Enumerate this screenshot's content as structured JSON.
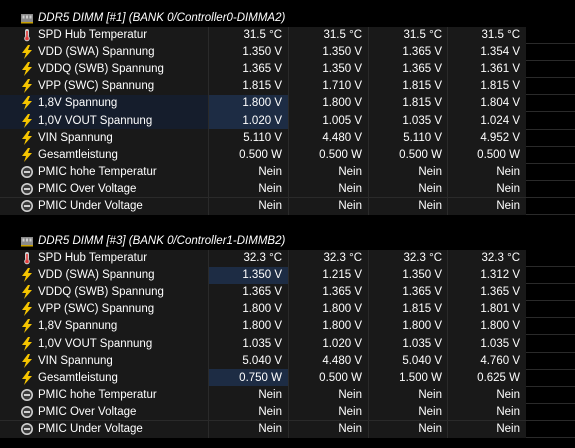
{
  "groups": [
    {
      "title": "DDR5 DIMM [#1] (BANK 0/Controller0-DIMMA2)",
      "rows": [
        {
          "icon": "thermometer-icon",
          "label": "SPD Hub Temperatur",
          "values": [
            "31.5 °C",
            "31.5 °C",
            "31.5 °C",
            "31.5 °C"
          ],
          "highlight": [
            false,
            false,
            false,
            false
          ]
        },
        {
          "icon": "lightning-icon",
          "label": "VDD (SWA) Spannung",
          "values": [
            "1.350 V",
            "1.350 V",
            "1.365 V",
            "1.354 V"
          ],
          "highlight": [
            false,
            false,
            false,
            false
          ]
        },
        {
          "icon": "lightning-icon",
          "label": "VDDQ (SWB) Spannung",
          "values": [
            "1.365 V",
            "1.350 V",
            "1.365 V",
            "1.361 V"
          ],
          "highlight": [
            false,
            false,
            false,
            false
          ]
        },
        {
          "icon": "lightning-icon",
          "label": "VPP (SWC) Spannung",
          "values": [
            "1.815 V",
            "1.710 V",
            "1.815 V",
            "1.815 V"
          ],
          "highlight": [
            false,
            false,
            false,
            false
          ]
        },
        {
          "icon": "lightning-icon",
          "label": "1,8V Spannung",
          "values": [
            "1.800 V",
            "1.800 V",
            "1.815 V",
            "1.804 V"
          ],
          "highlight": [
            true,
            false,
            false,
            false
          ],
          "row_hl": true
        },
        {
          "icon": "lightning-icon",
          "label": "1,0V VOUT Spannung",
          "values": [
            "1.020 V",
            "1.005 V",
            "1.035 V",
            "1.024 V"
          ],
          "highlight": [
            true,
            false,
            false,
            false
          ],
          "row_hl": true
        },
        {
          "icon": "lightning-icon",
          "label": "VIN Spannung",
          "values": [
            "5.110 V",
            "4.480 V",
            "5.110 V",
            "4.952 V"
          ],
          "highlight": [
            false,
            false,
            false,
            false
          ]
        },
        {
          "icon": "lightning-icon",
          "label": "Gesamtleistung",
          "values": [
            "0.500 W",
            "0.500 W",
            "0.500 W",
            "0.500 W"
          ],
          "highlight": [
            false,
            false,
            false,
            false
          ]
        },
        {
          "icon": "status-circle-icon",
          "label": "PMIC hohe Temperatur",
          "values": [
            "Nein",
            "Nein",
            "Nein",
            "Nein"
          ],
          "highlight": [
            false,
            false,
            false,
            false
          ]
        },
        {
          "icon": "status-circle-icon",
          "label": "PMIC Over Voltage",
          "values": [
            "Nein",
            "Nein",
            "Nein",
            "Nein"
          ],
          "highlight": [
            false,
            false,
            false,
            false
          ]
        },
        {
          "icon": "status-circle-icon",
          "label": "PMIC Under Voltage",
          "values": [
            "Nein",
            "Nein",
            "Nein",
            "Nein"
          ],
          "highlight": [
            false,
            false,
            false,
            false
          ]
        }
      ]
    },
    {
      "title": "DDR5 DIMM [#3] (BANK 0/Controller1-DIMMB2)",
      "rows": [
        {
          "icon": "thermometer-icon",
          "label": "SPD Hub Temperatur",
          "values": [
            "32.3 °C",
            "32.3 °C",
            "32.3 °C",
            "32.3 °C"
          ],
          "highlight": [
            false,
            false,
            false,
            false
          ]
        },
        {
          "icon": "lightning-icon",
          "label": "VDD (SWA) Spannung",
          "values": [
            "1.350 V",
            "1.215 V",
            "1.350 V",
            "1.312 V"
          ],
          "highlight": [
            true,
            false,
            false,
            false
          ]
        },
        {
          "icon": "lightning-icon",
          "label": "VDDQ (SWB) Spannung",
          "values": [
            "1.365 V",
            "1.365 V",
            "1.365 V",
            "1.365 V"
          ],
          "highlight": [
            false,
            false,
            false,
            false
          ]
        },
        {
          "icon": "lightning-icon",
          "label": "VPP (SWC) Spannung",
          "values": [
            "1.800 V",
            "1.800 V",
            "1.815 V",
            "1.801 V"
          ],
          "highlight": [
            false,
            false,
            false,
            false
          ]
        },
        {
          "icon": "lightning-icon",
          "label": "1,8V Spannung",
          "values": [
            "1.800 V",
            "1.800 V",
            "1.800 V",
            "1.800 V"
          ],
          "highlight": [
            false,
            false,
            false,
            false
          ]
        },
        {
          "icon": "lightning-icon",
          "label": "1,0V VOUT Spannung",
          "values": [
            "1.035 V",
            "1.020 V",
            "1.035 V",
            "1.035 V"
          ],
          "highlight": [
            false,
            false,
            false,
            false
          ]
        },
        {
          "icon": "lightning-icon",
          "label": "VIN Spannung",
          "values": [
            "5.040 V",
            "4.480 V",
            "5.040 V",
            "4.760 V"
          ],
          "highlight": [
            false,
            false,
            false,
            false
          ]
        },
        {
          "icon": "lightning-icon",
          "label": "Gesamtleistung",
          "values": [
            "0.750 W",
            "0.500 W",
            "1.500 W",
            "0.625 W"
          ],
          "highlight": [
            true,
            false,
            false,
            false
          ]
        },
        {
          "icon": "status-circle-icon",
          "label": "PMIC hohe Temperatur",
          "values": [
            "Nein",
            "Nein",
            "Nein",
            "Nein"
          ],
          "highlight": [
            false,
            false,
            false,
            false
          ]
        },
        {
          "icon": "status-circle-icon",
          "label": "PMIC Over Voltage",
          "values": [
            "Nein",
            "Nein",
            "Nein",
            "Nein"
          ],
          "highlight": [
            false,
            false,
            false,
            false
          ]
        },
        {
          "icon": "status-circle-icon",
          "label": "PMIC Under Voltage",
          "values": [
            "Nein",
            "Nein",
            "Nein",
            "Nein"
          ],
          "highlight": [
            false,
            false,
            false,
            false
          ]
        }
      ]
    }
  ],
  "colors": {
    "background": "#000000",
    "row": "#191919",
    "highlight": "#1d2c44",
    "lightning": "#f5c400",
    "text": "#ffffff"
  }
}
